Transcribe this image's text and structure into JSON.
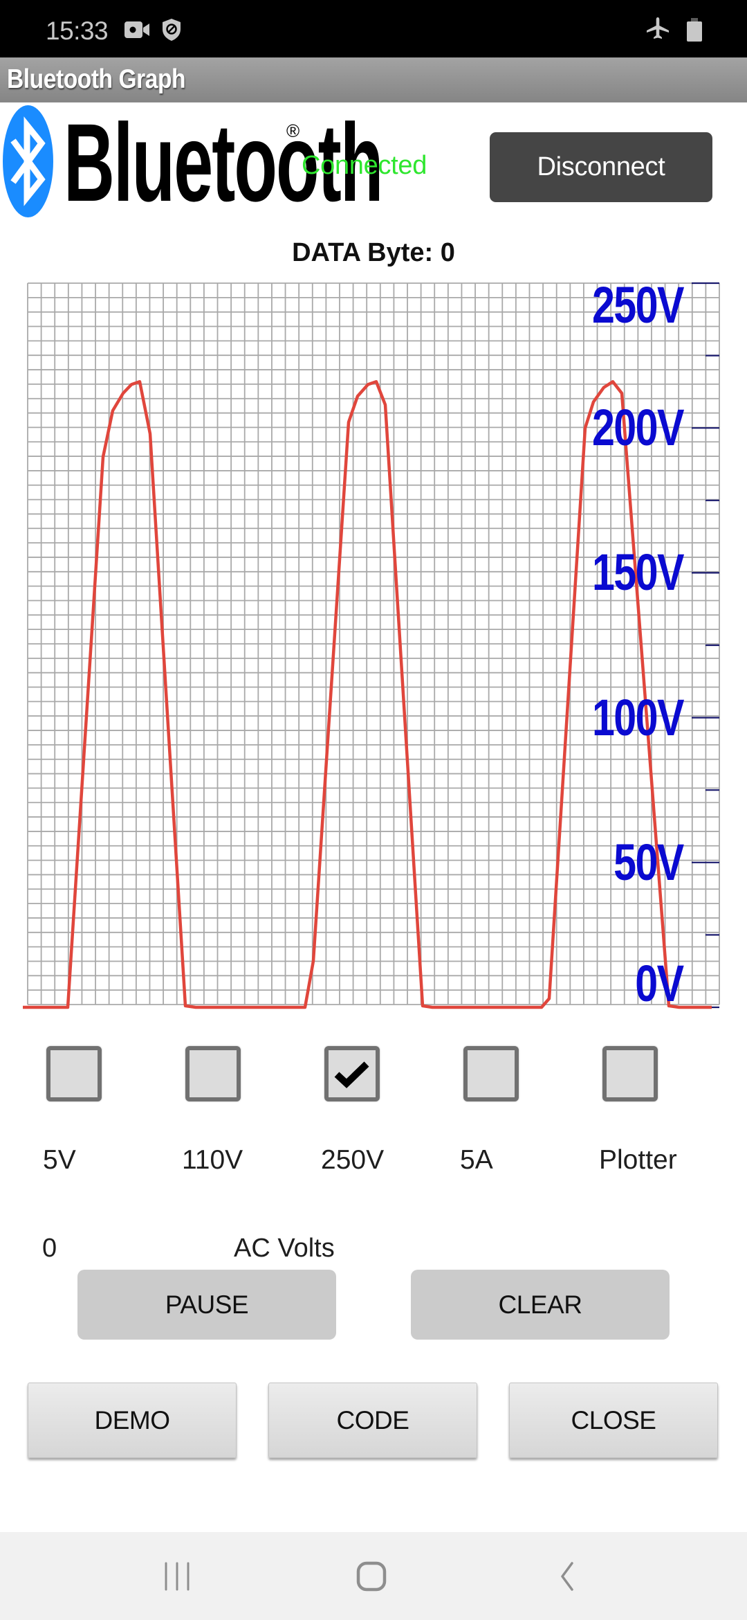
{
  "status_bar": {
    "time": "15:33",
    "left_icons": [
      "video-camera-icon",
      "shield-block-icon"
    ],
    "right_icons": [
      "airplane-mode-icon",
      "battery-icon"
    ]
  },
  "app": {
    "title": "Bluetooth Graph"
  },
  "header": {
    "logo_text": "Bluetooth",
    "logo_registered": "®",
    "connection_status": "Connected",
    "connection_color": "#2ee62e",
    "disconnect_label": "Disconnect"
  },
  "data_byte_label": "DATA Byte: 0",
  "chart_data": {
    "type": "line",
    "title": "",
    "xlabel": "",
    "ylabel": "",
    "ylim": [
      0,
      250
    ],
    "y_tick_labels": [
      "250V",
      "200V",
      "150V",
      "100V",
      "50V",
      "0V"
    ],
    "y_ticks": [
      250,
      225,
      200,
      175,
      150,
      125,
      100,
      75,
      50,
      25,
      0
    ],
    "grid": true,
    "line_color": "#e0463c",
    "label_color": "#0a0ad0",
    "xlim": [
      0,
      100
    ],
    "series": [
      {
        "name": "AC Volts",
        "points": [
          [
            -0.7,
            0
          ],
          [
            5.8,
            0
          ],
          [
            10.9,
            190
          ],
          [
            12.3,
            206
          ],
          [
            13.8,
            212
          ],
          [
            15.0,
            215
          ],
          [
            16.2,
            216
          ],
          [
            17.7,
            198
          ],
          [
            22.8,
            0.5
          ],
          [
            24.3,
            0
          ],
          [
            25.5,
            0
          ],
          [
            40.1,
            0
          ],
          [
            41.3,
            16
          ],
          [
            46.4,
            202
          ],
          [
            47.7,
            211
          ],
          [
            49.2,
            215
          ],
          [
            50.4,
            216
          ],
          [
            51.7,
            208
          ],
          [
            57.1,
            0.5
          ],
          [
            58.5,
            0
          ],
          [
            74.3,
            0
          ],
          [
            75.4,
            3
          ],
          [
            80.6,
            200
          ],
          [
            81.8,
            209
          ],
          [
            83.3,
            214
          ],
          [
            84.6,
            216
          ],
          [
            85.9,
            212
          ],
          [
            92.7,
            0.5
          ],
          [
            94.2,
            0
          ],
          [
            98.9,
            0
          ]
        ]
      }
    ]
  },
  "options": [
    {
      "label": "5V",
      "checked": false
    },
    {
      "label": "110V",
      "checked": false
    },
    {
      "label": "250V",
      "checked": true
    },
    {
      "label": "5A",
      "checked": false
    },
    {
      "label": "Plotter",
      "checked": false
    }
  ],
  "readout": {
    "value": "0",
    "unit": "AC Volts"
  },
  "buttons": {
    "pause": "PAUSE",
    "clear": "CLEAR",
    "demo": "DEMO",
    "code": "CODE",
    "close": "CLOSE"
  },
  "nav_bar": {
    "icons": [
      "recent-apps-icon",
      "home-icon",
      "back-icon"
    ]
  }
}
